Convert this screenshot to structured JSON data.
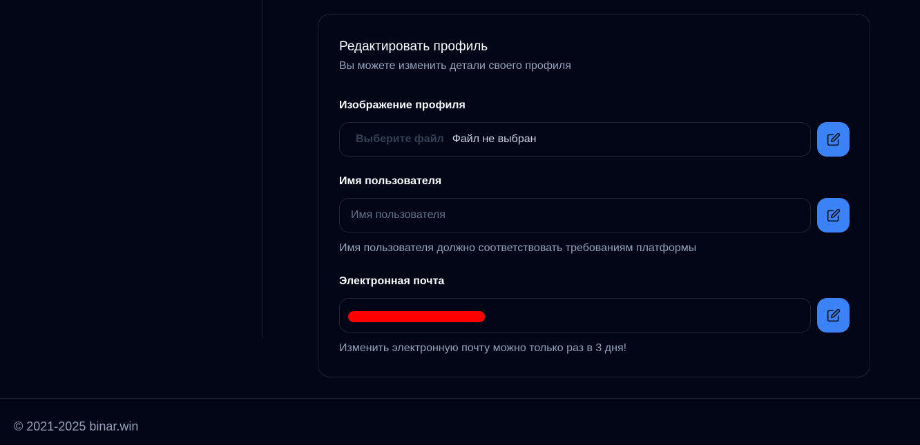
{
  "profile_card": {
    "title": "Редактировать профиль",
    "subtitle": "Вы можете изменить детали своего профиля",
    "avatar_field": {
      "label": "Изображение профиля",
      "choose_button": "Выберите файл",
      "status": "Файл не выбран",
      "edit_icon": "pencil-square-icon"
    },
    "username_field": {
      "label": "Имя пользователя",
      "placeholder": "Имя пользователя",
      "value": "",
      "helper": "Имя пользователя должно соответствовать требованиям платформы",
      "edit_icon": "pencil-square-icon"
    },
    "email_field": {
      "label": "Электронная почта",
      "value_redacted": true,
      "helper": "Изменить электронную почту можно только раз в 3 дня!",
      "edit_icon": "pencil-square-icon"
    }
  },
  "footer": {
    "copyright": "© 2021-2025 binar.win"
  },
  "colors": {
    "background": "#020617",
    "accent": "#3b82f6",
    "border": "#1e2636",
    "muted_text": "#94a3b8",
    "redaction": "#ff0000"
  }
}
